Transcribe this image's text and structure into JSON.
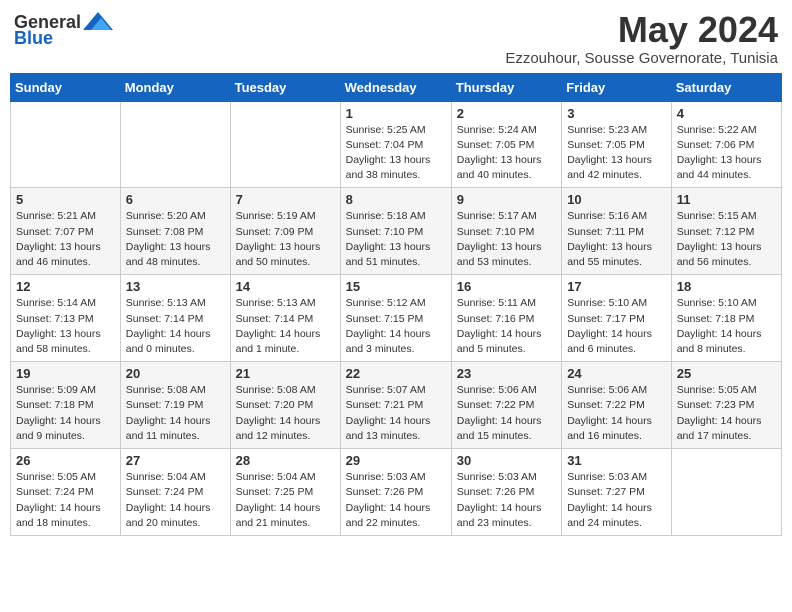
{
  "header": {
    "logo_general": "General",
    "logo_blue": "Blue",
    "month_year": "May 2024",
    "location": "Ezzouhour, Sousse Governorate, Tunisia"
  },
  "weekdays": [
    "Sunday",
    "Monday",
    "Tuesday",
    "Wednesday",
    "Thursday",
    "Friday",
    "Saturday"
  ],
  "weeks": [
    [
      {
        "day": "",
        "info": ""
      },
      {
        "day": "",
        "info": ""
      },
      {
        "day": "",
        "info": ""
      },
      {
        "day": "1",
        "info": "Sunrise: 5:25 AM\nSunset: 7:04 PM\nDaylight: 13 hours\nand 38 minutes."
      },
      {
        "day": "2",
        "info": "Sunrise: 5:24 AM\nSunset: 7:05 PM\nDaylight: 13 hours\nand 40 minutes."
      },
      {
        "day": "3",
        "info": "Sunrise: 5:23 AM\nSunset: 7:05 PM\nDaylight: 13 hours\nand 42 minutes."
      },
      {
        "day": "4",
        "info": "Sunrise: 5:22 AM\nSunset: 7:06 PM\nDaylight: 13 hours\nand 44 minutes."
      }
    ],
    [
      {
        "day": "5",
        "info": "Sunrise: 5:21 AM\nSunset: 7:07 PM\nDaylight: 13 hours\nand 46 minutes."
      },
      {
        "day": "6",
        "info": "Sunrise: 5:20 AM\nSunset: 7:08 PM\nDaylight: 13 hours\nand 48 minutes."
      },
      {
        "day": "7",
        "info": "Sunrise: 5:19 AM\nSunset: 7:09 PM\nDaylight: 13 hours\nand 50 minutes."
      },
      {
        "day": "8",
        "info": "Sunrise: 5:18 AM\nSunset: 7:10 PM\nDaylight: 13 hours\nand 51 minutes."
      },
      {
        "day": "9",
        "info": "Sunrise: 5:17 AM\nSunset: 7:10 PM\nDaylight: 13 hours\nand 53 minutes."
      },
      {
        "day": "10",
        "info": "Sunrise: 5:16 AM\nSunset: 7:11 PM\nDaylight: 13 hours\nand 55 minutes."
      },
      {
        "day": "11",
        "info": "Sunrise: 5:15 AM\nSunset: 7:12 PM\nDaylight: 13 hours\nand 56 minutes."
      }
    ],
    [
      {
        "day": "12",
        "info": "Sunrise: 5:14 AM\nSunset: 7:13 PM\nDaylight: 13 hours\nand 58 minutes."
      },
      {
        "day": "13",
        "info": "Sunrise: 5:13 AM\nSunset: 7:14 PM\nDaylight: 14 hours\nand 0 minutes."
      },
      {
        "day": "14",
        "info": "Sunrise: 5:13 AM\nSunset: 7:14 PM\nDaylight: 14 hours\nand 1 minute."
      },
      {
        "day": "15",
        "info": "Sunrise: 5:12 AM\nSunset: 7:15 PM\nDaylight: 14 hours\nand 3 minutes."
      },
      {
        "day": "16",
        "info": "Sunrise: 5:11 AM\nSunset: 7:16 PM\nDaylight: 14 hours\nand 5 minutes."
      },
      {
        "day": "17",
        "info": "Sunrise: 5:10 AM\nSunset: 7:17 PM\nDaylight: 14 hours\nand 6 minutes."
      },
      {
        "day": "18",
        "info": "Sunrise: 5:10 AM\nSunset: 7:18 PM\nDaylight: 14 hours\nand 8 minutes."
      }
    ],
    [
      {
        "day": "19",
        "info": "Sunrise: 5:09 AM\nSunset: 7:18 PM\nDaylight: 14 hours\nand 9 minutes."
      },
      {
        "day": "20",
        "info": "Sunrise: 5:08 AM\nSunset: 7:19 PM\nDaylight: 14 hours\nand 11 minutes."
      },
      {
        "day": "21",
        "info": "Sunrise: 5:08 AM\nSunset: 7:20 PM\nDaylight: 14 hours\nand 12 minutes."
      },
      {
        "day": "22",
        "info": "Sunrise: 5:07 AM\nSunset: 7:21 PM\nDaylight: 14 hours\nand 13 minutes."
      },
      {
        "day": "23",
        "info": "Sunrise: 5:06 AM\nSunset: 7:22 PM\nDaylight: 14 hours\nand 15 minutes."
      },
      {
        "day": "24",
        "info": "Sunrise: 5:06 AM\nSunset: 7:22 PM\nDaylight: 14 hours\nand 16 minutes."
      },
      {
        "day": "25",
        "info": "Sunrise: 5:05 AM\nSunset: 7:23 PM\nDaylight: 14 hours\nand 17 minutes."
      }
    ],
    [
      {
        "day": "26",
        "info": "Sunrise: 5:05 AM\nSunset: 7:24 PM\nDaylight: 14 hours\nand 18 minutes."
      },
      {
        "day": "27",
        "info": "Sunrise: 5:04 AM\nSunset: 7:24 PM\nDaylight: 14 hours\nand 20 minutes."
      },
      {
        "day": "28",
        "info": "Sunrise: 5:04 AM\nSunset: 7:25 PM\nDaylight: 14 hours\nand 21 minutes."
      },
      {
        "day": "29",
        "info": "Sunrise: 5:03 AM\nSunset: 7:26 PM\nDaylight: 14 hours\nand 22 minutes."
      },
      {
        "day": "30",
        "info": "Sunrise: 5:03 AM\nSunset: 7:26 PM\nDaylight: 14 hours\nand 23 minutes."
      },
      {
        "day": "31",
        "info": "Sunrise: 5:03 AM\nSunset: 7:27 PM\nDaylight: 14 hours\nand 24 minutes."
      },
      {
        "day": "",
        "info": ""
      }
    ]
  ]
}
